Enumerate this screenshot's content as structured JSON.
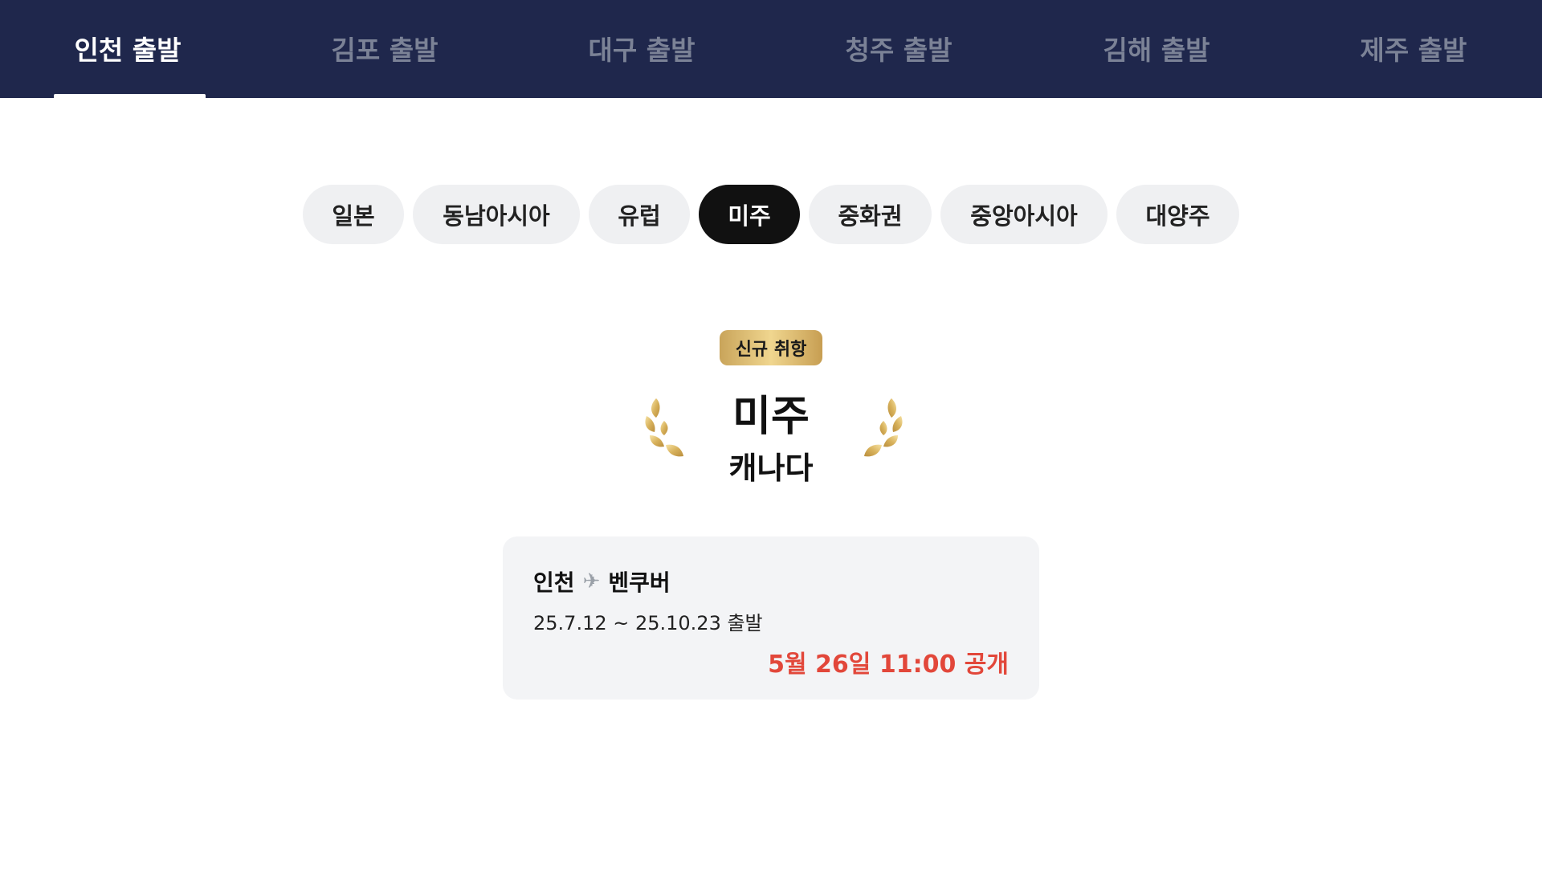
{
  "departure_tabs": [
    {
      "label": "인천 출발",
      "active": true
    },
    {
      "label": "김포 출발",
      "active": false
    },
    {
      "label": "대구 출발",
      "active": false
    },
    {
      "label": "청주 출발",
      "active": false
    },
    {
      "label": "김해 출발",
      "active": false
    },
    {
      "label": "제주 출발",
      "active": false
    }
  ],
  "region_chips": [
    {
      "label": "일본",
      "active": false
    },
    {
      "label": "동남아시아",
      "active": false
    },
    {
      "label": "유럽",
      "active": false
    },
    {
      "label": "미주",
      "active": true
    },
    {
      "label": "중화권",
      "active": false
    },
    {
      "label": "중앙아시아",
      "active": false
    },
    {
      "label": "대양주",
      "active": false
    }
  ],
  "feature": {
    "badge": "신규 취항",
    "region": "미주",
    "country": "캐나다"
  },
  "route_card": {
    "origin": "인천",
    "plane_icon": "✈",
    "destination": "벤쿠버",
    "dates": "25.7.12 ~ 25.10.23 출발",
    "open_time": "5월 26일 11:00 공개"
  },
  "colors": {
    "nav_bg": "#1f274c",
    "accent_red": "#e2473a",
    "gold": "#d4b068"
  }
}
